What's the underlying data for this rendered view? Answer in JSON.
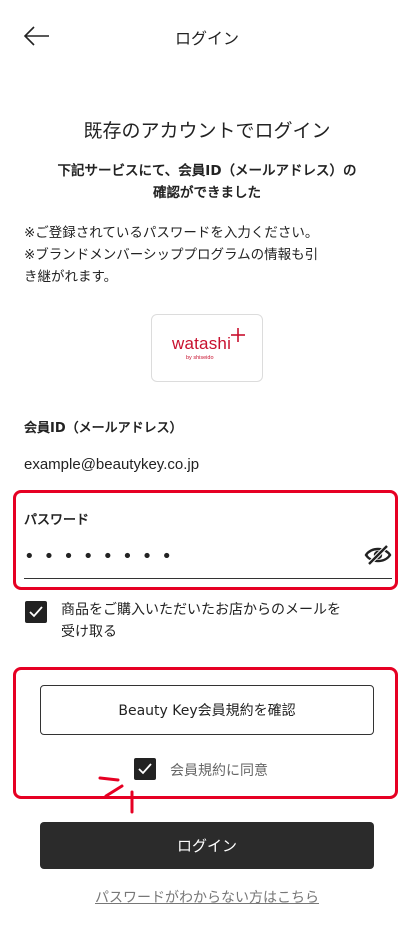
{
  "header": {
    "title": "ログイン"
  },
  "page_title": "既存のアカウントでログイン",
  "confirm_message": {
    "line1": "下記サービスにて、会員ID（メールアドレス）の",
    "line2": "確認ができました"
  },
  "notes": {
    "line1": "※ご登録されているパスワードを入力ください。",
    "line2": "※ブランドメンバーシッププログラムの情報も引",
    "line3": "き継がれます。"
  },
  "service_logo": {
    "word": "watashi",
    "sub": "by shiseido",
    "color": "#c8102e"
  },
  "member_id": {
    "label": "会員ID（メールアドレス）",
    "value": "example@beautykey.co.jp"
  },
  "password": {
    "label": "パスワード",
    "value": "••••••••"
  },
  "mail_optin": {
    "checked": true,
    "line1": "商品をご購入いただいたお店からのメールを",
    "line2": "受け取る"
  },
  "terms": {
    "button_label": "Beauty Key会員規約を確認",
    "agree_label": "会員規約に同意",
    "agree_checked": true
  },
  "login_button": "ログイン",
  "forgot_link": "パスワードがわからない方はこちら",
  "colors": {
    "highlight": "#e60023",
    "primary_button": "#2b2b2b",
    "brand": "#c8102e"
  }
}
